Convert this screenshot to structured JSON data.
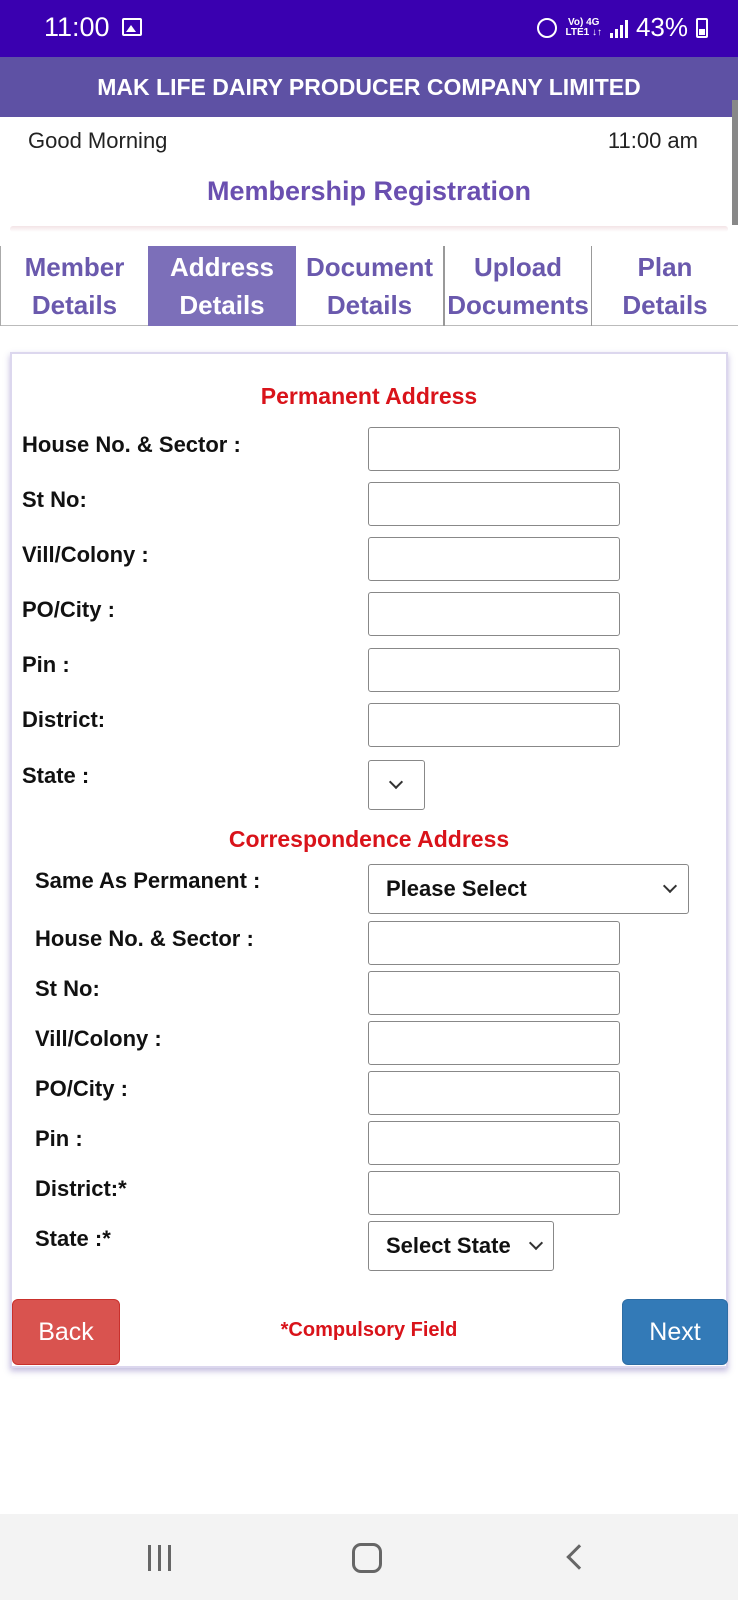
{
  "status_bar": {
    "time": "11:00",
    "network_top": "Vo) 4G",
    "network_bottom": "LTE1 ↓↑",
    "battery": "43%",
    "icons": [
      "gallery-icon",
      "alarm-icon",
      "signal-icon",
      "battery-icon"
    ]
  },
  "header": {
    "company": "MAK LIFE DAIRY PRODUCER COMPANY LIMITED"
  },
  "greeting": "Good Morning",
  "clock": "11:00 am",
  "page_title": "Membership Registration",
  "tabs": [
    {
      "line1": "Member",
      "line2": "Details",
      "active": false
    },
    {
      "line1": "Address",
      "line2": "Details",
      "active": true
    },
    {
      "line1": "Document",
      "line2": "Details",
      "active": false
    },
    {
      "line1": "Upload",
      "line2": "Documents",
      "active": false
    },
    {
      "line1": "Plan",
      "line2": "Details",
      "active": false
    }
  ],
  "permanent": {
    "title": "Permanent Address",
    "house_label": "House No. & Sector :",
    "st_label": "St No:",
    "vill_label": "Vill/Colony :",
    "po_label": "PO/City :",
    "pin_label": "Pin :",
    "district_label": "District:",
    "state_label": "State :",
    "state_value": ""
  },
  "correspondence": {
    "title": "Correspondence Address",
    "same_label": "Same As Permanent :",
    "same_value": "Please Select",
    "house_label": "House No. & Sector :",
    "st_label": "St No:",
    "vill_label": "Vill/Colony :",
    "po_label": "PO/City :",
    "pin_label": "Pin :",
    "district_label": "District:*",
    "state_label": "State :*",
    "state_value": "Select State"
  },
  "buttons": {
    "back": "Back",
    "next": "Next"
  },
  "compulsory_note": "*Compulsory Field",
  "colors": {
    "status_bar": "#3a00b0",
    "header": "#5e51a4",
    "accent_purple": "#6a4fb0",
    "active_tab": "#7c6fb9",
    "section_red": "#d9131a",
    "back_button": "#d9534f",
    "next_button": "#337ab7"
  }
}
